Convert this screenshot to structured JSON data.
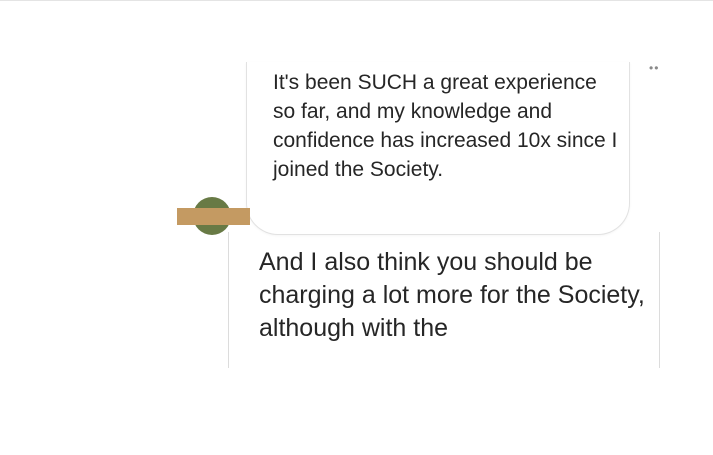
{
  "bubble": {
    "message": "It's been SUCH a great experience so far, and my knowledge and confidence has increased 10x since I joined the Society."
  },
  "back_card": {
    "message": "And I also think you should be charging a lot more for the Society, although with the"
  },
  "menu": {
    "icon": "more-dots-icon",
    "glyph": "••"
  },
  "colors": {
    "avatar": "#687a45",
    "redaction": "#c49a62"
  }
}
